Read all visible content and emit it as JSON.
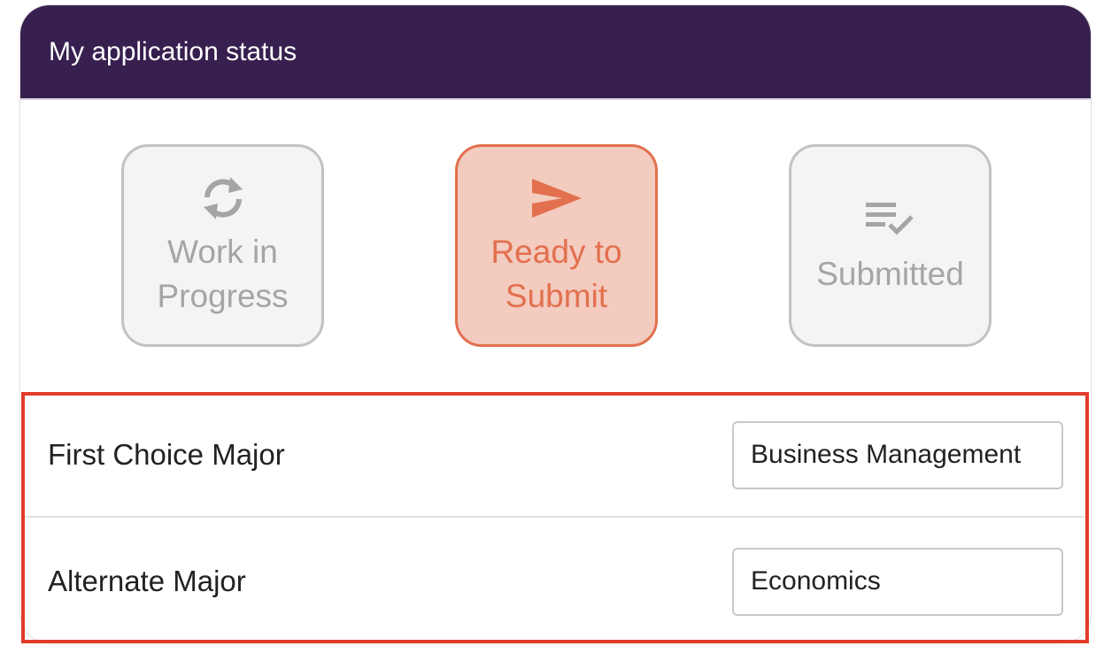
{
  "header": {
    "title": "My application status"
  },
  "steps": [
    {
      "label": "Work in Progress",
      "icon": "sync-icon",
      "state": "inactive"
    },
    {
      "label": "Ready to Submit",
      "icon": "send-icon",
      "state": "active"
    },
    {
      "label": "Submitted",
      "icon": "checklist-icon",
      "state": "inactive"
    }
  ],
  "majors": {
    "first_label": "First Choice Major",
    "first_value": "Business Management",
    "alternate_label": "Alternate Major",
    "alternate_value": "Economics"
  },
  "colors": {
    "header_bg": "#371f4f",
    "active_border": "#e2704e",
    "active_bg": "#f3cbbf",
    "inactive_border": "#c2c2c2",
    "inactive_text": "#a5a5a5",
    "highlight_border": "#e03c2a"
  }
}
